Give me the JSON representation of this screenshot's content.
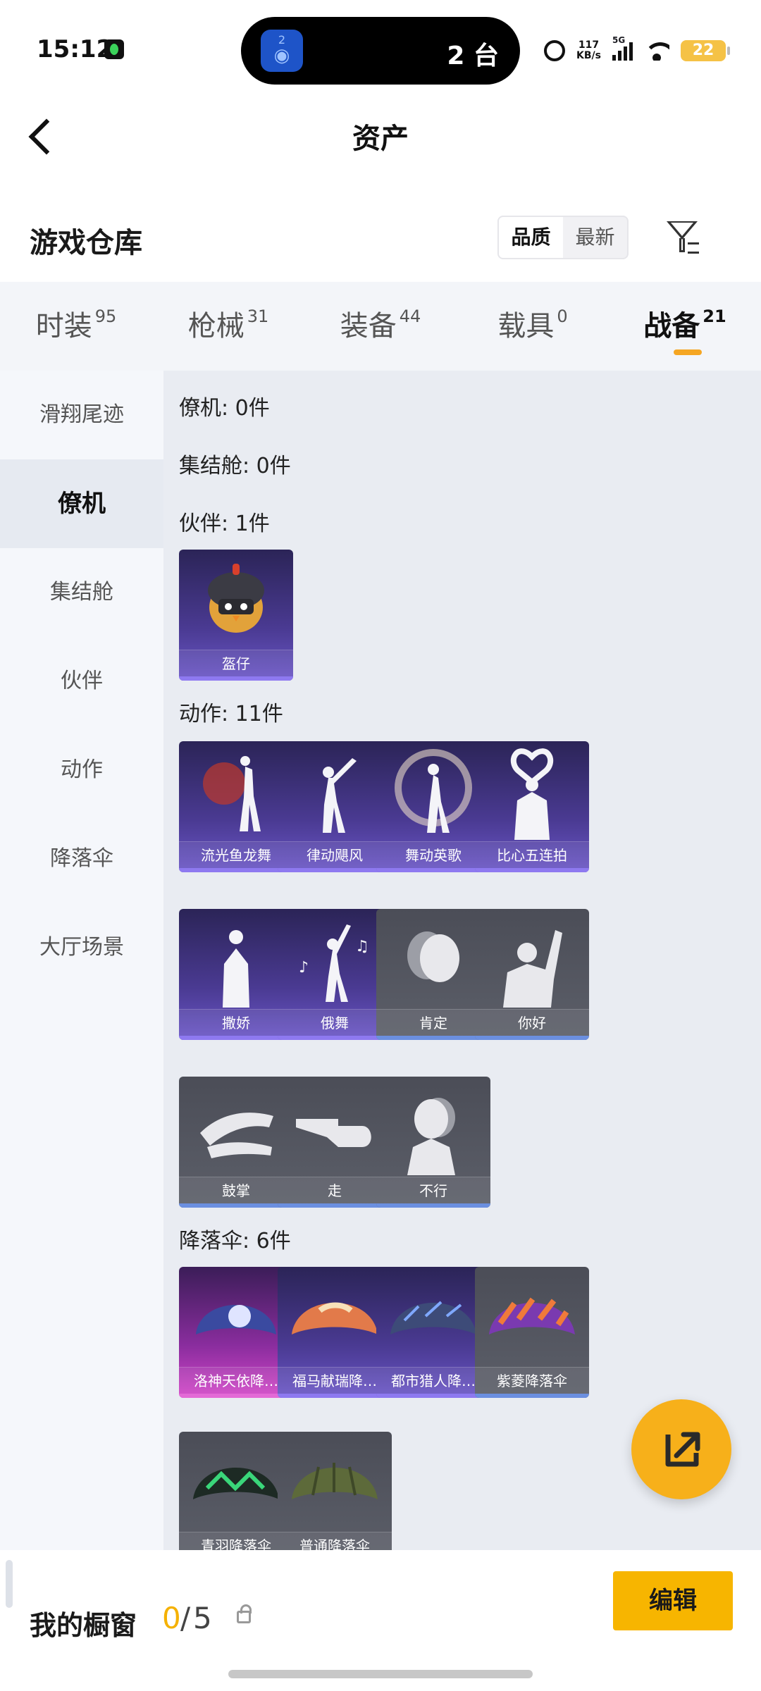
{
  "status_bar": {
    "time": "15:12",
    "island_badge": "2",
    "device_count": "2 台",
    "net_speed_value": "117",
    "net_speed_unit": "KB/s",
    "network": "5G",
    "battery": "22"
  },
  "header": {
    "title": "资产"
  },
  "warehouse": {
    "title": "游戏仓库",
    "sort_options": [
      "品质",
      "最新"
    ],
    "sort_active": "品质"
  },
  "tabs": [
    {
      "label": "时装",
      "count": "95"
    },
    {
      "label": "枪械",
      "count": "31"
    },
    {
      "label": "装备",
      "count": "44"
    },
    {
      "label": "载具",
      "count": "0"
    },
    {
      "label": "战备",
      "count": "21"
    }
  ],
  "sidebar": {
    "items": [
      "滑翔尾迹",
      "僚机",
      "集结舱",
      "伙伴",
      "动作",
      "降落伞",
      "大厅场景"
    ],
    "active_index": 1
  },
  "sections": {
    "wingman": "僚机: 0件",
    "pod": "集结舱: 0件",
    "partner": "伙伴: 1件",
    "emote": "动作: 11件",
    "parachute": "降落伞: 6件"
  },
  "partner_items": [
    "盔仔"
  ],
  "emote_items": [
    "流光鱼龙舞",
    "律动飓风",
    "舞动英歌",
    "比心五连拍",
    "撒娇",
    "俄舞",
    "肯定",
    "你好",
    "鼓掌",
    "走",
    "不行"
  ],
  "parachute_items": [
    "洛神天依降…",
    "福马献瑞降…",
    "都市猎人降…",
    "紫菱降落伞",
    "青羽降落伞",
    "普通降落伞"
  ],
  "bottom": {
    "label": "我的橱窗",
    "used": "0",
    "separator": "/",
    "total": "5",
    "edit_label": "编辑"
  },
  "colors": {
    "accent": "#f5b100",
    "tab_indicator": "#f5a623",
    "card_purple": "#4a3a92",
    "card_gray": "#5c5f69",
    "card_pink": "#d347c8"
  }
}
